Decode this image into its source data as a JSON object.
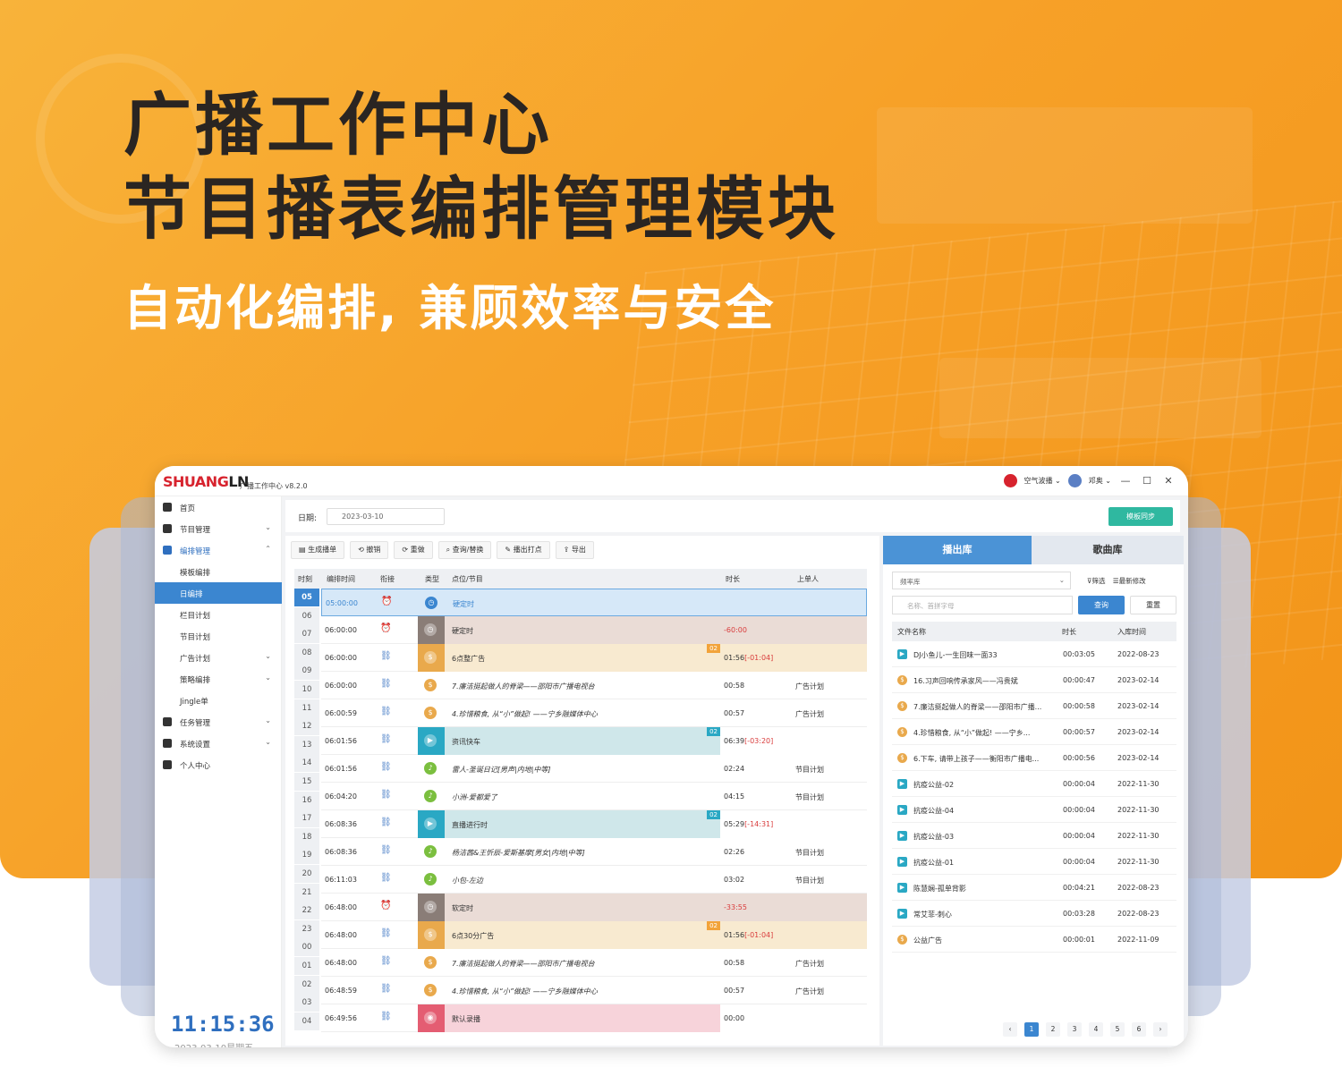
{
  "hero": {
    "title_line1": "广播工作中心",
    "title_line2": "节目播表编排管理模块",
    "subtitle": "自动化编排, 兼顾效率与安全"
  },
  "app": {
    "logo_red": "SHUANG",
    "logo_black": "LN",
    "name": "广播工作中心 v8.2.0",
    "channel": "空气波播",
    "user": "邓奥",
    "minimize": "—",
    "maximize": "☐",
    "close": "✕"
  },
  "sidebar": {
    "items": [
      {
        "label": "首页",
        "icon": "home-icon"
      },
      {
        "label": "节目管理",
        "icon": "program-icon",
        "chevron": "⌄"
      },
      {
        "label": "编排管理",
        "icon": "schedule-icon",
        "chevron": "⌃"
      },
      {
        "label": "模板编排"
      },
      {
        "label": "日编排"
      },
      {
        "label": "栏目计划"
      },
      {
        "label": "节目计划"
      },
      {
        "label": "广告计划",
        "chevron": "⌄"
      },
      {
        "label": "策略编排",
        "chevron": "⌄"
      },
      {
        "label": "Jingle单"
      },
      {
        "label": "任务管理",
        "icon": "task-icon",
        "chevron": "⌄"
      },
      {
        "label": "系统设置",
        "icon": "settings-icon",
        "chevron": "⌄"
      },
      {
        "label": "个人中心",
        "icon": "user-icon"
      }
    ],
    "clock": "11:15:36",
    "date": "2023-03-10星期五"
  },
  "datebar": {
    "label": "日期:",
    "value": "2023-03-10",
    "sync": "模板同步"
  },
  "toolbar": [
    "生成播单",
    "撤销",
    "重做",
    "查询/替换",
    "播出打点",
    "导出"
  ],
  "grid": {
    "headers": [
      "时刻",
      "编排时间",
      "衔接",
      "类型",
      "点位/节目",
      "时长",
      "上单人"
    ],
    "hours": [
      "05",
      "06",
      "07",
      "08",
      "09",
      "10",
      "11",
      "12",
      "13",
      "14",
      "15",
      "16",
      "17",
      "18",
      "19",
      "20",
      "21",
      "22",
      "23",
      "00",
      "01",
      "02",
      "03",
      "04"
    ],
    "rows": [
      {
        "time": "05:00:00",
        "name": "硬定时",
        "dur": "",
        "neg": "",
        "by": "",
        "kind": "clock",
        "bg": "#d6e8f8",
        "badge": ""
      },
      {
        "time": "06:00:00",
        "name": "硬定时",
        "dur": "",
        "neg": "-60:00",
        "by": "",
        "kind": "clock",
        "bg": "#eadcd6",
        "badge": ""
      },
      {
        "time": "06:00:00",
        "name": "6点整广告",
        "dur": "01:56",
        "neg": "[-01:04]",
        "by": "",
        "kind": "ad",
        "bg": "#f8ead0",
        "badge": "02"
      },
      {
        "time": "06:00:00",
        "name": "7.廉洁挺起做人的脊梁——邵阳市广播电视台",
        "dur": "00:58",
        "neg": "",
        "by": "广告计划",
        "kind": "ad",
        "bg": "",
        "badge": ""
      },
      {
        "time": "06:00:59",
        "name": "4.珍惜粮食, 从“小”做起! ——宁乡融媒体中心",
        "dur": "00:57",
        "neg": "",
        "by": "广告计划",
        "kind": "ad",
        "bg": "",
        "badge": ""
      },
      {
        "time": "06:01:56",
        "name": "资讯快车",
        "dur": "06:39",
        "neg": "[-03:20]",
        "by": "",
        "kind": "video",
        "bg": "#cfe7ea",
        "badge": "02"
      },
      {
        "time": "06:01:56",
        "name": "雷人-圣诞日记[男声|内地|中等]",
        "dur": "02:24",
        "neg": "",
        "by": "节目计划",
        "kind": "music",
        "bg": "",
        "badge": ""
      },
      {
        "time": "06:04:20",
        "name": "小洲-爱都爱了",
        "dur": "04:15",
        "neg": "",
        "by": "节目计划",
        "kind": "music",
        "bg": "",
        "badge": ""
      },
      {
        "time": "06:08:36",
        "name": "直播进行时",
        "dur": "05:29",
        "neg": "[-14:31]",
        "by": "",
        "kind": "video",
        "bg": "#cfe7ea",
        "badge": "02"
      },
      {
        "time": "06:08:36",
        "name": "杨洁茜&王忻辰-爱斯基摩[男女|内地|中等]",
        "dur": "02:26",
        "neg": "",
        "by": "节目计划",
        "kind": "music",
        "bg": "",
        "badge": ""
      },
      {
        "time": "06:11:03",
        "name": "小包-左边",
        "dur": "03:02",
        "neg": "",
        "by": "节目计划",
        "kind": "music",
        "bg": "",
        "badge": ""
      },
      {
        "time": "06:48:00",
        "name": "软定时",
        "dur": "",
        "neg": "-33:55",
        "by": "",
        "kind": "clock",
        "bg": "#eadcd6",
        "badge": ""
      },
      {
        "time": "06:48:00",
        "name": "6点30分广告",
        "dur": "01:56",
        "neg": "[-01:04]",
        "by": "",
        "kind": "ad",
        "bg": "#f8ead0",
        "badge": "02"
      },
      {
        "time": "06:48:00",
        "name": "7.廉洁挺起做人的脊梁——邵阳市广播电视台",
        "dur": "00:58",
        "neg": "",
        "by": "广告计划",
        "kind": "ad",
        "bg": "",
        "badge": ""
      },
      {
        "time": "06:48:59",
        "name": "4.珍惜粮食, 从“小”做起! ——宁乡融媒体中心",
        "dur": "00:57",
        "neg": "",
        "by": "广告计划",
        "kind": "ad",
        "bg": "",
        "badge": ""
      },
      {
        "time": "06:49:56",
        "name": "默认录播",
        "dur": "00:00",
        "neg": "",
        "by": "",
        "kind": "record",
        "bg": "#f7d3da",
        "badge": ""
      }
    ]
  },
  "library": {
    "tab_active": "播出库",
    "tab_inactive": "歌曲库",
    "select": "频率库",
    "filter": "筛选",
    "latest": "最新修改",
    "search_placeholder": "名称、首拼字母",
    "query": "查询",
    "reset": "重置",
    "headers": [
      "文件名称",
      "时长",
      "入库时间"
    ],
    "items": [
      {
        "kind": "video",
        "name": "DJ小鱼儿-一生回味一面33",
        "dur": "00:03:05",
        "date": "2022-08-23"
      },
      {
        "kind": "ad",
        "name": "16.习声回响传承家风——冯贵斌",
        "dur": "00:00:47",
        "date": "2023-02-14"
      },
      {
        "kind": "ad",
        "name": "7.廉洁挺起做人的脊梁——邵阳市广播...",
        "dur": "00:00:58",
        "date": "2023-02-14"
      },
      {
        "kind": "ad",
        "name": "4.珍惜粮食, 从“小”做起! ——宁乡...",
        "dur": "00:00:57",
        "date": "2023-02-14"
      },
      {
        "kind": "ad",
        "name": "6.下车, 请带上孩子——衡阳市广播电...",
        "dur": "00:00:56",
        "date": "2023-02-14"
      },
      {
        "kind": "video",
        "name": "抗疫公益-02",
        "dur": "00:00:04",
        "date": "2022-11-30"
      },
      {
        "kind": "video",
        "name": "抗疫公益-04",
        "dur": "00:00:04",
        "date": "2022-11-30"
      },
      {
        "kind": "video",
        "name": "抗疫公益-03",
        "dur": "00:00:04",
        "date": "2022-11-30"
      },
      {
        "kind": "video",
        "name": "抗疫公益-01",
        "dur": "00:00:04",
        "date": "2022-11-30"
      },
      {
        "kind": "video",
        "name": "陈慧娴-孤单背影",
        "dur": "00:04:21",
        "date": "2022-08-23"
      },
      {
        "kind": "video",
        "name": "常艾菲-刺心",
        "dur": "00:03:28",
        "date": "2022-08-23"
      },
      {
        "kind": "ad",
        "name": "公益广告",
        "dur": "00:00:01",
        "date": "2022-11-09"
      }
    ],
    "pages": [
      "‹",
      "1",
      "2",
      "3",
      "4",
      "5",
      "6",
      "›"
    ],
    "current_page": "1"
  },
  "colors": {
    "accent": "#3b86d0",
    "ad": "#e9a94c",
    "music": "#7bbf3f",
    "video": "#2aa8c4",
    "clock": "#8a7d77",
    "record": "#e45d72",
    "timebadge": "#4f82c8"
  }
}
